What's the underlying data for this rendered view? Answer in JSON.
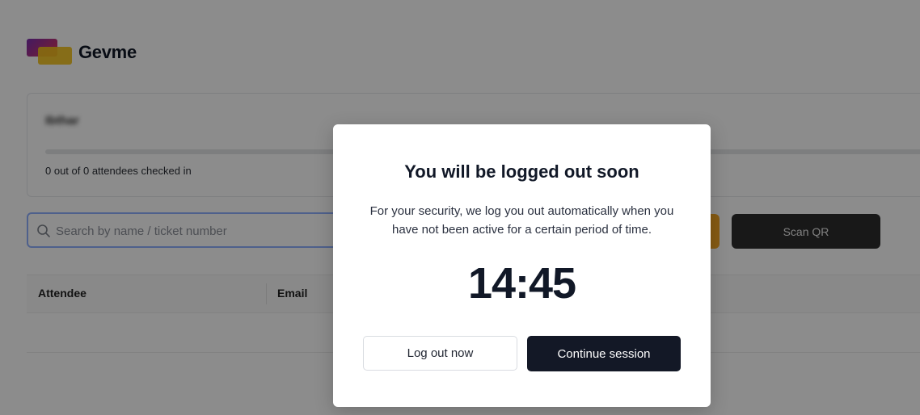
{
  "brand": {
    "name": "Gevme"
  },
  "event": {
    "name": "Ibthar",
    "checked_in_text": "0 out of 0 attendees checked in",
    "checked_in_fraction": 0
  },
  "search": {
    "placeholder": "Search by name / ticket number",
    "value": ""
  },
  "actions": {
    "scan_qr_label": "Scan QR"
  },
  "table": {
    "columns": [
      "Attendee",
      "Email"
    ]
  },
  "modal": {
    "title": "You will be logged out soon",
    "message": "For your security, we log you out automatically when you have not been active for a certain period of time.",
    "countdown": "14:45",
    "logout_label": "Log out now",
    "continue_label": "Continue session"
  },
  "colors": {
    "primary_dark": "#131826",
    "accent_orange": "#f5a623",
    "scan_button": "#2d2d2d"
  },
  "icons": {
    "search": "search-icon"
  }
}
